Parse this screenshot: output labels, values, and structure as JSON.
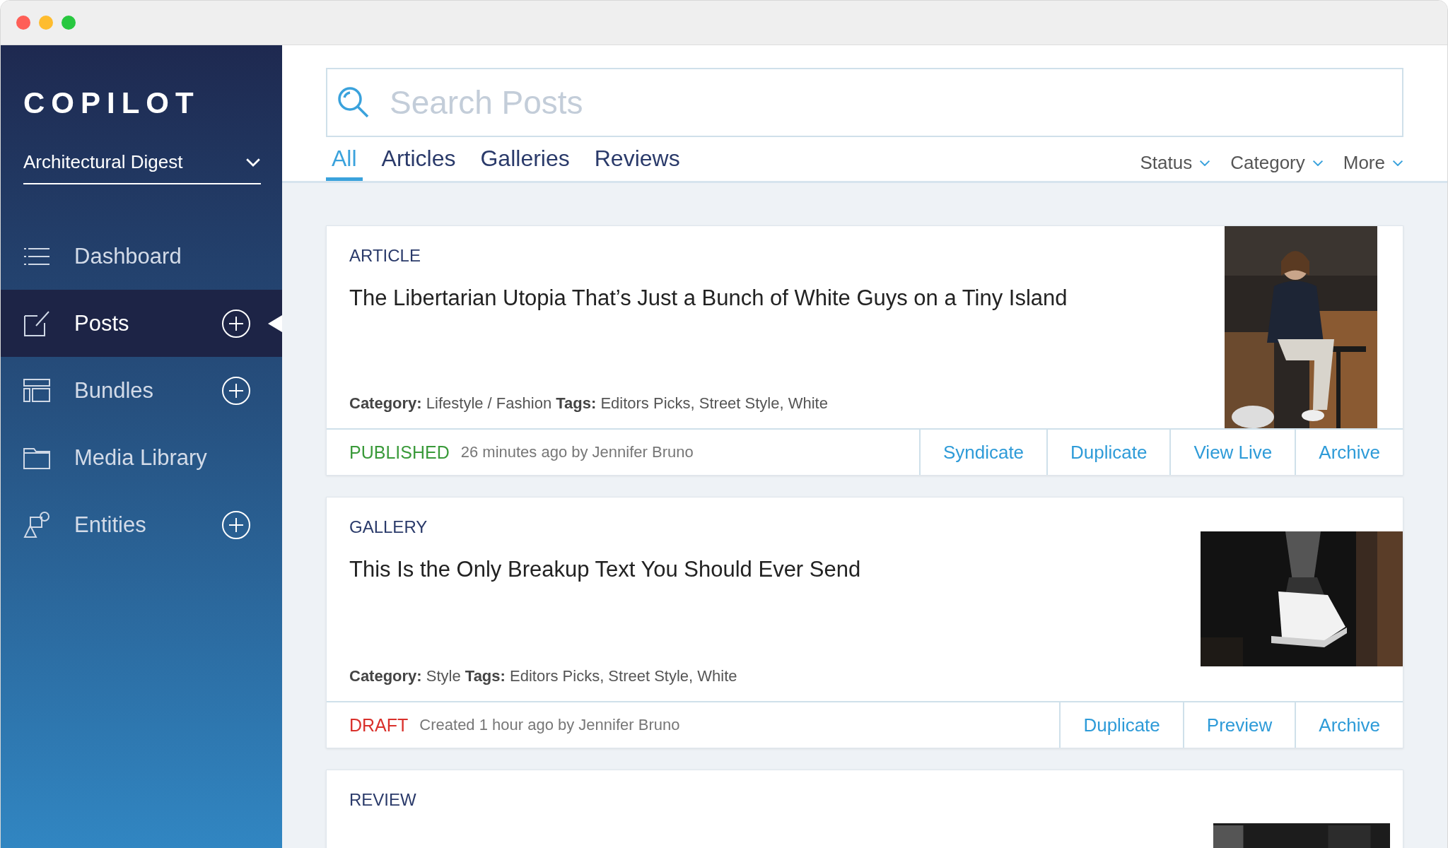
{
  "sidebar": {
    "logo": "COPILOT",
    "publication": "Architectural Digest",
    "items": [
      {
        "kind": "dashboard",
        "label": "Dashboard",
        "selected": false,
        "add": false
      },
      {
        "kind": "posts",
        "label": "Posts",
        "selected": true,
        "add": true
      },
      {
        "kind": "bundles",
        "label": "Bundles",
        "selected": false,
        "add": true
      },
      {
        "kind": "media",
        "label": "Media Library",
        "selected": false,
        "add": false
      },
      {
        "kind": "entities",
        "label": "Entities",
        "selected": false,
        "add": true
      }
    ]
  },
  "search": {
    "placeholder": "Search Posts"
  },
  "tabs": [
    {
      "label": "All",
      "selected": true
    },
    {
      "label": "Articles",
      "selected": false
    },
    {
      "label": "Galleries",
      "selected": false
    },
    {
      "label": "Reviews",
      "selected": false
    }
  ],
  "filters": [
    "Status",
    "Category",
    "More"
  ],
  "posts": [
    {
      "type": "ARTICLE",
      "title": "The Libertarian Utopia That’s Just a Bunch of White Guys on a Tiny Island",
      "details": "**Category:** Lifestyle / Fashion  **Tags:** Editors Picks, Street Style, White",
      "picture": {
        "kind": "person"
      },
      "status": {
        "kind": "published",
        "label": "PUBLISHED"
      },
      "meta": "26 minutes ago by Jennifer Bruno",
      "actions": [
        "Syndicate",
        "Duplicate",
        "View Live",
        "Archive"
      ]
    },
    {
      "type": "GALLERY",
      "title": "This Is the Only Breakup Text You Should Ever Send",
      "details": "**Category:** Style   **Tags:** Editors Picks, Street Style, White",
      "picture": {
        "kind": "shoe"
      },
      "status": {
        "kind": "draft",
        "label": "DRAFT"
      },
      "meta": "Created 1 hour ago by Jennifer Bruno",
      "actions": [
        "Duplicate",
        "Preview",
        "Archive"
      ]
    },
    {
      "type": "REVIEW",
      "picture": {
        "kind": "object"
      }
    }
  ]
}
